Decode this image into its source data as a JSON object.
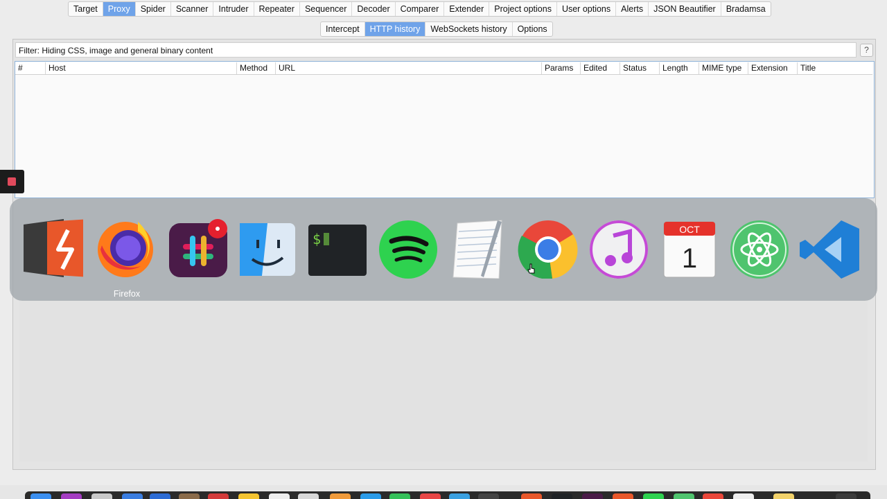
{
  "top_tabs": {
    "items": [
      "Target",
      "Proxy",
      "Spider",
      "Scanner",
      "Intruder",
      "Repeater",
      "Sequencer",
      "Decoder",
      "Comparer",
      "Extender",
      "Project options",
      "User options",
      "Alerts",
      "JSON Beautifier",
      "Bradamsa"
    ],
    "active": "Proxy"
  },
  "sub_tabs": {
    "items": [
      "Intercept",
      "HTTP history",
      "WebSockets history",
      "Options"
    ],
    "active": "HTTP history"
  },
  "filter": {
    "text": "Filter: Hiding CSS, image and general binary content",
    "help_label": "?"
  },
  "table": {
    "columns": [
      "#",
      "Host",
      "Method",
      "URL",
      "Params",
      "Edited",
      "Status",
      "Length",
      "MIME type",
      "Extension",
      "Title"
    ],
    "rows": []
  },
  "app_switcher": {
    "selected_label": "Firefox",
    "apps": [
      {
        "name": "burp-suite-icon"
      },
      {
        "name": "firefox-icon"
      },
      {
        "name": "slack-icon"
      },
      {
        "name": "finder-icon"
      },
      {
        "name": "terminal-icon",
        "glyph": "$"
      },
      {
        "name": "spotify-icon"
      },
      {
        "name": "textedit-icon"
      },
      {
        "name": "chrome-icon"
      },
      {
        "name": "itunes-icon"
      },
      {
        "name": "calendar-icon",
        "month": "OCT",
        "day": "1"
      },
      {
        "name": "atom-icon"
      },
      {
        "name": "vscode-icon"
      }
    ]
  },
  "colors": {
    "active_tab": "#6fa3e9",
    "stop_button": "#e14a5c"
  }
}
